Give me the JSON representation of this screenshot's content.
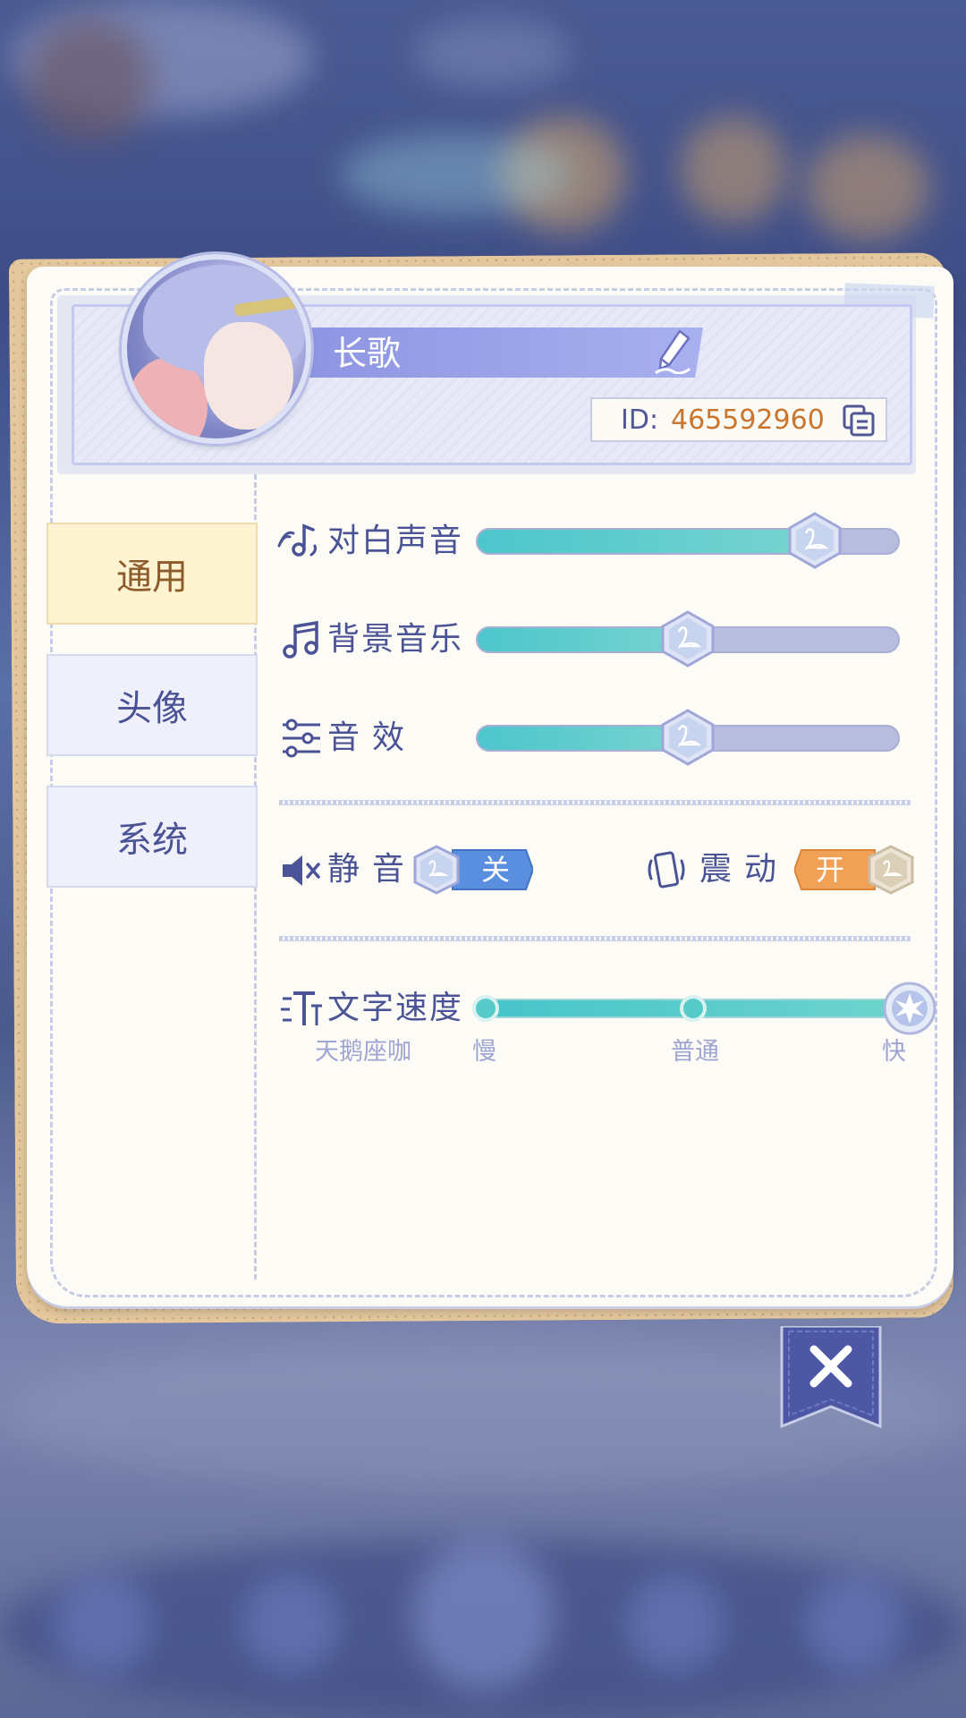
{
  "profile": {
    "name": "长歌",
    "id_label": "ID:",
    "id_value": "465592960"
  },
  "tabs": [
    {
      "label": "通用",
      "active": true
    },
    {
      "label": "头像",
      "active": false
    },
    {
      "label": "系统",
      "active": false
    }
  ],
  "audio": {
    "dialogue": {
      "label": "对白声音",
      "level": 0.8
    },
    "bgm": {
      "label": "背景音乐",
      "level": 0.5
    },
    "sfx": {
      "label": "音效",
      "level": 0.5
    }
  },
  "mute": {
    "label": "静音",
    "state_text": "关"
  },
  "vibrate": {
    "label": "震动",
    "state_text": "开"
  },
  "text_speed": {
    "label": "文字速度",
    "preview_text": "天鹅座咖",
    "options": [
      "慢",
      "普通",
      "快"
    ],
    "selected": "快"
  },
  "colors": {
    "accent": "#4a5395",
    "slider_fill": "#4cc6cc",
    "id_value": "#c9752e",
    "toggle_off": "#5a8fe0",
    "toggle_on": "#f0a155"
  }
}
